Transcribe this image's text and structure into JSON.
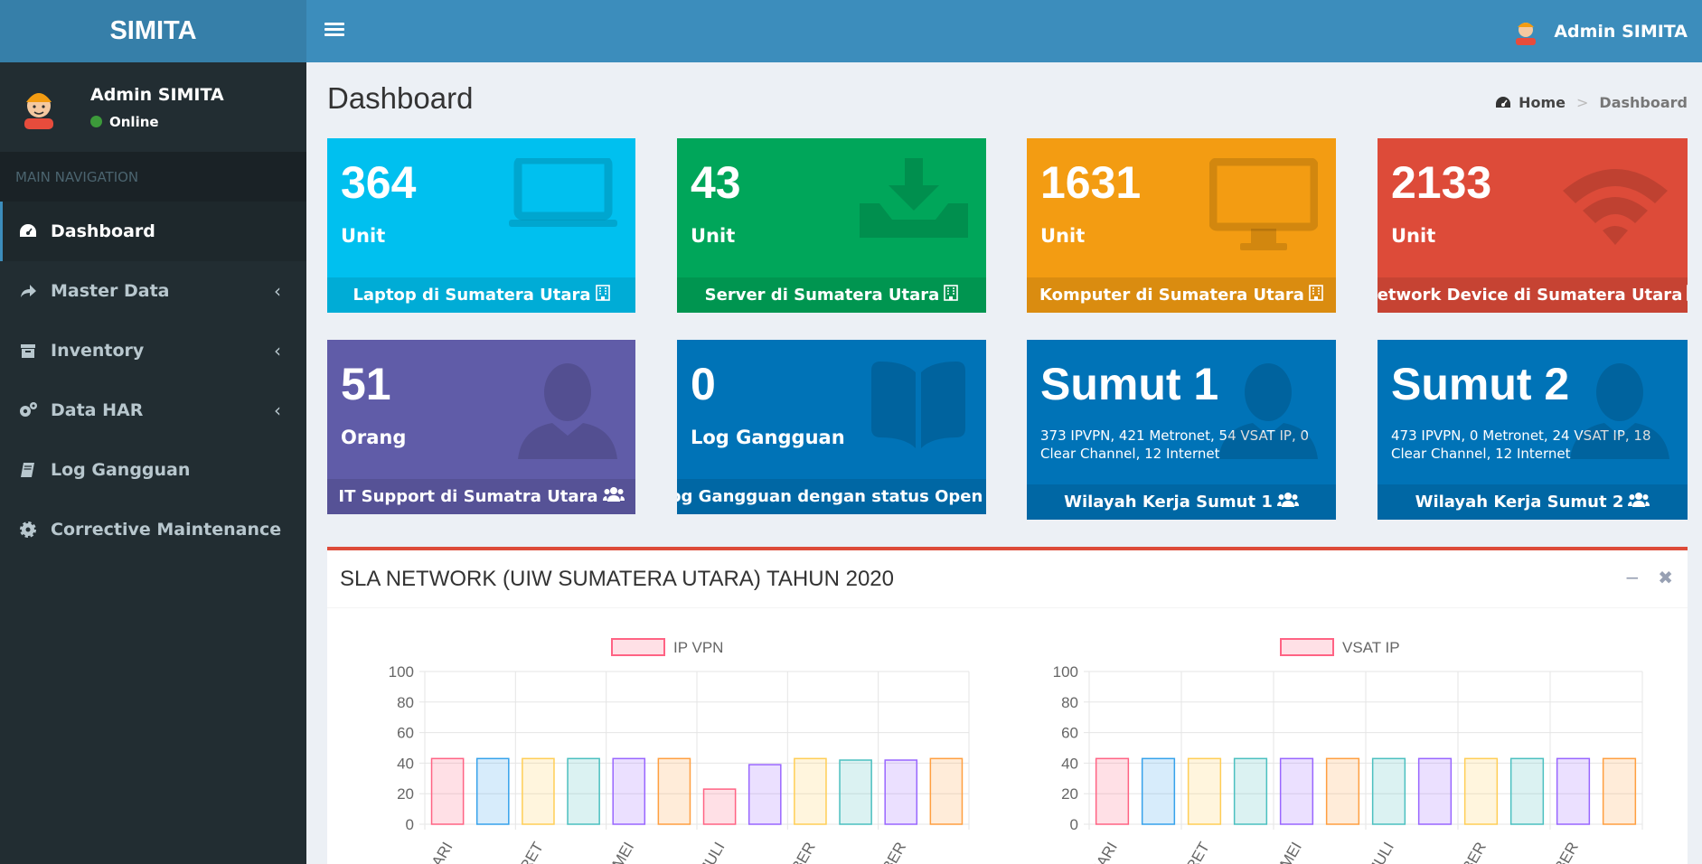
{
  "app": {
    "logo": "SIMITA"
  },
  "topbar": {
    "user_name": "Admin SIMITA"
  },
  "sidebar": {
    "user_name": "Admin SIMITA",
    "status": "Online",
    "nav_header": "MAIN NAVIGATION",
    "items": [
      {
        "label": "Dashboard",
        "icon": "dashboard-icon",
        "active": true
      },
      {
        "label": "Master Data",
        "icon": "share-icon",
        "chevron": "‹"
      },
      {
        "label": "Inventory",
        "icon": "archive-icon",
        "chevron": "‹"
      },
      {
        "label": "Data HAR",
        "icon": "gears-icon",
        "chevron": "‹"
      },
      {
        "label": "Log Gangguan",
        "icon": "book-icon"
      },
      {
        "label": "Corrective Maintenance",
        "icon": "gear-icon"
      }
    ]
  },
  "page": {
    "title": "Dashboard"
  },
  "breadcrumb": {
    "home": "Home",
    "separator": ">",
    "current": "Dashboard"
  },
  "boxes": [
    {
      "value": "364",
      "label": "Unit",
      "footer": "Laptop di Sumatera Utara",
      "color": "#00c0ef",
      "icon": "laptop-icon"
    },
    {
      "value": "43",
      "label": "Unit",
      "footer": "Server di Sumatera Utara",
      "color": "#00a65a",
      "icon": "download-icon"
    },
    {
      "value": "1631",
      "label": "Unit",
      "footer": "Komputer di Sumatera Utara",
      "color": "#f39c12",
      "icon": "desktop-icon"
    },
    {
      "value": "2133",
      "label": "Unit",
      "footer": "Network Device di Sumatera Utara",
      "color": "#dd4b39",
      "icon": "wifi-icon"
    },
    {
      "value": "51",
      "label": "Orang",
      "footer": "IT Support di Sumatra Utara",
      "color": "#605ca8",
      "icon": "user-icon"
    },
    {
      "value": "0",
      "label": "Log Gangguan",
      "footer": "Log Gangguan dengan status Open",
      "color": "#0073b7",
      "icon": "book-open-icon"
    },
    {
      "value": "Sumut 1",
      "sub": "373 IPVPN, 421 Metronet, 54 VSAT IP, 0 Clear Channel, 12 Internet",
      "footer": "Wilayah Kerja Sumut 1",
      "color": "#0073b7",
      "icon": "user-icon"
    },
    {
      "value": "Sumut 2",
      "sub": "473 IPVPN, 0 Metronet, 24 VSAT IP, 18 Clear Channel, 12 Internet",
      "footer": "Wilayah Kerja Sumut 2",
      "color": "#0073b7",
      "icon": "user-icon"
    }
  ],
  "panel": {
    "title": "SLA NETWORK (UIW SUMATERA UTARA) TAHUN 2020",
    "minimize": "−",
    "close": "✖"
  },
  "chart_data": [
    {
      "type": "bar",
      "legend": "IP VPN",
      "ylim": [
        0,
        100
      ],
      "yticks": [
        0,
        20,
        40,
        60,
        80,
        100
      ],
      "x_tick_labels": [
        "UARI",
        "ARET",
        "MEI",
        "JULI",
        "MBER",
        "MBER"
      ],
      "values": [
        43,
        43,
        43,
        43,
        43,
        43,
        23,
        39,
        43,
        42,
        42,
        43
      ],
      "colors": [
        "#ff6384",
        "#36a2eb",
        "#ffce56",
        "#4bc0c0",
        "#9966ff",
        "#ff9f40",
        "#ff6384",
        "#9966ff",
        "#ffce56",
        "#4bc0c0",
        "#9966ff",
        "#ff9f40"
      ],
      "legend_position": "top"
    },
    {
      "type": "bar",
      "legend": "VSAT IP",
      "ylim": [
        0,
        100
      ],
      "yticks": [
        0,
        20,
        40,
        60,
        80,
        100
      ],
      "x_tick_labels": [
        "UARI",
        "ARET",
        "MEI",
        "JULI",
        "MBER",
        "MBER"
      ],
      "values": [
        43,
        43,
        43,
        43,
        43,
        43,
        43,
        43,
        43,
        43,
        43,
        43
      ],
      "colors": [
        "#ff6384",
        "#36a2eb",
        "#ffce56",
        "#4bc0c0",
        "#9966ff",
        "#ff9f40",
        "#4bc0c0",
        "#9966ff",
        "#ffce56",
        "#4bc0c0",
        "#9966ff",
        "#ff9f40"
      ],
      "legend_position": "top"
    }
  ]
}
